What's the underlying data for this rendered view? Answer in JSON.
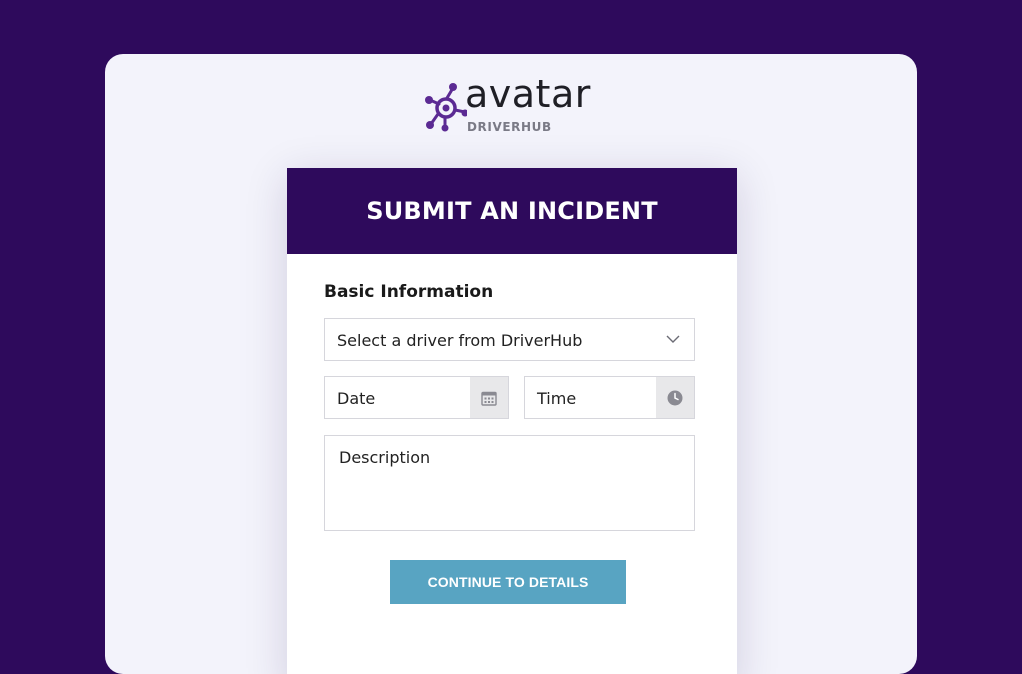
{
  "brand": {
    "name": "avatar",
    "sub": "DRIVERHUB",
    "accent_color": "#2e0a5c",
    "logo_icon": "network-node-icon"
  },
  "form": {
    "title": "SUBMIT AN INCIDENT",
    "section_title": "Basic Information",
    "driver_select": {
      "selected": "Select a driver from DriverHub",
      "icon": "chevron-down-icon"
    },
    "date": {
      "placeholder": "Date",
      "icon": "calendar-icon"
    },
    "time": {
      "placeholder": "Time",
      "icon": "clock-icon"
    },
    "description": {
      "placeholder": "Description"
    },
    "continue_label": "CONTINUE TO DETAILS",
    "button_color": "#58a4c2"
  }
}
